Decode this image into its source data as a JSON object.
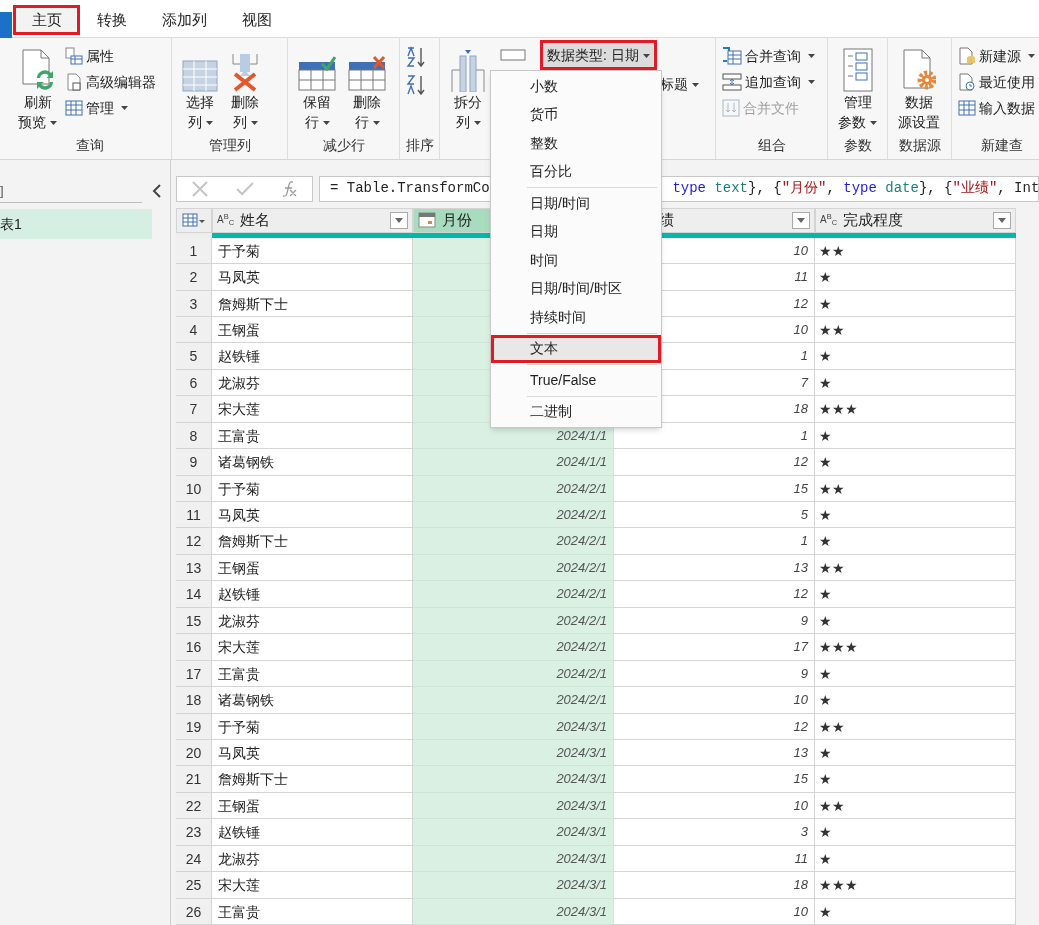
{
  "ribbon_tabs": [
    {
      "label": "主页",
      "selected": true,
      "highlighted": true
    },
    {
      "label": "转换",
      "selected": false,
      "highlighted": false
    },
    {
      "label": "添加列",
      "selected": false,
      "highlighted": false
    },
    {
      "label": "视图",
      "selected": false,
      "highlighted": false
    }
  ],
  "ribbon_groups": [
    {
      "label": "查询",
      "items": [
        {
          "kind": "large",
          "lines": [
            "刷新",
            "预览"
          ],
          "dropdown": true
        },
        {
          "kind": "stack",
          "buttons": [
            {
              "label": "属性",
              "dropdown": false,
              "disabled": false
            },
            {
              "label": "高级编辑器",
              "dropdown": false,
              "disabled": false
            },
            {
              "label": "管理",
              "dropdown": true,
              "disabled": false
            }
          ]
        }
      ]
    },
    {
      "label": "管理列",
      "items": [
        {
          "kind": "large",
          "lines": [
            "选择",
            "列"
          ],
          "dropdown": true
        },
        {
          "kind": "large",
          "lines": [
            "删除",
            "列"
          ],
          "dropdown": true
        }
      ]
    },
    {
      "label": "减少行",
      "items": [
        {
          "kind": "large",
          "lines": [
            "保留",
            "行"
          ],
          "dropdown": true
        },
        {
          "kind": "large",
          "lines": [
            "删除",
            "行"
          ],
          "dropdown": true
        }
      ]
    },
    {
      "label": "排序",
      "items": [
        {
          "kind": "sort"
        }
      ]
    },
    {
      "items": [
        {
          "kind": "large",
          "lines": [
            "拆分",
            "列"
          ],
          "dropdown": true
        },
        {
          "kind": "transform",
          "data_type": {
            "label": "数据类型: 日期",
            "highlighted": true
          },
          "header_button": {
            "label": "标题",
            "dropdown": true
          }
        }
      ]
    },
    {
      "label": "组合",
      "items": [
        {
          "kind": "stack",
          "buttons": [
            {
              "label": "合并查询",
              "dropdown": true,
              "disabled": false
            },
            {
              "label": "追加查询",
              "dropdown": true,
              "disabled": false
            },
            {
              "label": "合并文件",
              "dropdown": false,
              "disabled": true
            }
          ]
        }
      ]
    },
    {
      "label": "参数",
      "items": [
        {
          "kind": "large",
          "lines": [
            "管理",
            "参数"
          ],
          "dropdown": true
        }
      ]
    },
    {
      "label": "数据源",
      "items": [
        {
          "kind": "large",
          "lines": [
            "数据",
            "源设置"
          ],
          "dropdown": false
        }
      ]
    },
    {
      "label": "新建查",
      "items": [
        {
          "kind": "stack",
          "buttons": [
            {
              "label": "新建源",
              "dropdown": true,
              "disabled": false
            },
            {
              "label": "最近使用",
              "dropdown": false,
              "disabled": false
            },
            {
              "label": "输入数据",
              "dropdown": false,
              "disabled": false
            }
          ]
        }
      ]
    }
  ],
  "queries_panel": {
    "header": "]",
    "items": [
      {
        "label": "表1",
        "selected": true
      }
    ]
  },
  "formula_bar": {
    "left": "= Table.TransformCo",
    "right": [
      {
        "kind": "keyword",
        "text": " type"
      },
      {
        "kind": "type",
        "text": " text"
      },
      {
        "kind": "plain",
        "text": "}, {"
      },
      {
        "kind": "string",
        "text": "\"月份\""
      },
      {
        "kind": "plain",
        "text": ", "
      },
      {
        "kind": "keyword",
        "text": "type"
      },
      {
        "kind": "type",
        "text": " date"
      },
      {
        "kind": "plain",
        "text": "}, {"
      },
      {
        "kind": "string",
        "text": "\"业绩\""
      },
      {
        "kind": "plain",
        "text": ", Int"
      }
    ]
  },
  "table": {
    "columns": [
      {
        "label": "姓名",
        "kind": "text",
        "type_label": "A$^{B}$$_{C}$",
        "filter": true,
        "selected": false
      },
      {
        "label": "月份",
        "kind": "date",
        "selected": true
      },
      {
        "label": "绩",
        "kind": "covered",
        "filter": true,
        "selected": false
      },
      {
        "label": "完成程度",
        "kind": "text",
        "type_label": "A$^{B}$$_{C}$",
        "filter": true,
        "selected": false
      }
    ],
    "rows": [
      {
        "index": "1",
        "name": "于予菊",
        "value": "10",
        "rating": "★★"
      },
      {
        "index": "2",
        "name": "马凤英",
        "value": "11",
        "rating": "★"
      },
      {
        "index": "3",
        "name": "詹姆斯下士",
        "value": "12",
        "rating": "★"
      },
      {
        "index": "4",
        "name": "王钢蛋",
        "value": "10",
        "rating": "★★"
      },
      {
        "index": "5",
        "name": "赵铁锤",
        "value": "1",
        "rating": "★"
      },
      {
        "index": "6",
        "name": "龙淑芬",
        "value": "7",
        "rating": "★"
      },
      {
        "index": "7",
        "name": "宋大莲",
        "value": "18",
        "rating": "★★★"
      },
      {
        "index": "8",
        "name": "王富贵",
        "month": "2024/1/1",
        "value": "1",
        "rating": "★"
      },
      {
        "index": "9",
        "name": "诸葛钢铁",
        "month": "2024/1/1",
        "value": "12",
        "rating": "★"
      },
      {
        "index": "10",
        "name": "于予菊",
        "month": "2024/2/1",
        "value": "15",
        "rating": "★★"
      },
      {
        "index": "11",
        "name": "马凤英",
        "month": "2024/2/1",
        "value": "5",
        "rating": "★"
      },
      {
        "index": "12",
        "name": "詹姆斯下士",
        "month": "2024/2/1",
        "value": "1",
        "rating": "★"
      },
      {
        "index": "13",
        "name": "王钢蛋",
        "month": "2024/2/1",
        "value": "13",
        "rating": "★★"
      },
      {
        "index": "14",
        "name": "赵铁锤",
        "month": "2024/2/1",
        "value": "12",
        "rating": "★"
      },
      {
        "index": "15",
        "name": "龙淑芬",
        "month": "2024/2/1",
        "value": "9",
        "rating": "★"
      },
      {
        "index": "16",
        "name": "宋大莲",
        "month": "2024/2/1",
        "value": "17",
        "rating": "★★★"
      },
      {
        "index": "17",
        "name": "王富贵",
        "month": "2024/2/1",
        "value": "9",
        "rating": "★"
      },
      {
        "index": "18",
        "name": "诸葛钢铁",
        "month": "2024/2/1",
        "value": "10",
        "rating": "★"
      },
      {
        "index": "19",
        "name": "于予菊",
        "month": "2024/3/1",
        "value": "12",
        "rating": "★★"
      },
      {
        "index": "20",
        "name": "马凤英",
        "month": "2024/3/1",
        "value": "13",
        "rating": "★"
      },
      {
        "index": "21",
        "name": "詹姆斯下士",
        "month": "2024/3/1",
        "value": "15",
        "rating": "★"
      },
      {
        "index": "22",
        "name": "王钢蛋",
        "month": "2024/3/1",
        "value": "10",
        "rating": "★★"
      },
      {
        "index": "23",
        "name": "赵铁锤",
        "month": "2024/3/1",
        "value": "3",
        "rating": "★"
      },
      {
        "index": "24",
        "name": "龙淑芬",
        "month": "2024/3/1",
        "value": "11",
        "rating": "★"
      },
      {
        "index": "25",
        "name": "宋大莲",
        "month": "2024/3/1",
        "value": "18",
        "rating": "★★★"
      },
      {
        "index": "26",
        "name": "王富贵",
        "month": "2024/3/1",
        "value": "10",
        "rating": "★"
      }
    ]
  },
  "type_menu": {
    "items": [
      {
        "label": "小数",
        "separator_before": false,
        "highlighted": false
      },
      {
        "label": "货币",
        "separator_before": false,
        "highlighted": false
      },
      {
        "label": "整数",
        "separator_before": false,
        "highlighted": false
      },
      {
        "label": "百分比",
        "separator_before": false,
        "highlighted": false
      },
      {
        "label": "日期/时间",
        "separator_before": true,
        "highlighted": false
      },
      {
        "label": "日期",
        "separator_before": false,
        "highlighted": false
      },
      {
        "label": "时间",
        "separator_before": false,
        "highlighted": false
      },
      {
        "label": "日期/时间/时区",
        "separator_before": false,
        "highlighted": false
      },
      {
        "label": "持续时间",
        "separator_before": false,
        "highlighted": false
      },
      {
        "label": "文本",
        "separator_before": true,
        "highlighted": true
      },
      {
        "label": "True/False",
        "separator_before": true,
        "highlighted": false
      },
      {
        "label": "二进制",
        "separator_before": true,
        "highlighted": false
      }
    ]
  }
}
